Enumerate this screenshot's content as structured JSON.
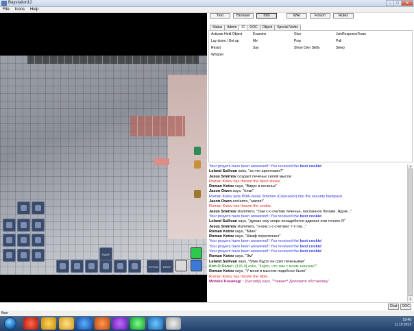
{
  "window": {
    "title": "Baystation12"
  },
  "menu": [
    "File",
    "Icons",
    "Help"
  ],
  "tabs": {
    "top": [
      {
        "label": "Text",
        "active": false
      },
      {
        "label": "Browser",
        "active": false
      },
      {
        "label": "Info",
        "active": true
      },
      {
        "label": "Wiki",
        "active": false
      },
      {
        "label": "Forum",
        "active": false
      },
      {
        "label": "Rules",
        "active": false
      }
    ],
    "stat": [
      {
        "label": "Status",
        "active": false
      },
      {
        "label": "Admin",
        "active": false
      },
      {
        "label": "IC",
        "active": true
      },
      {
        "label": "OOC",
        "active": false
      },
      {
        "label": "Object",
        "active": false
      },
      {
        "label": "Special Verbs",
        "active": false
      }
    ]
  },
  "verbs": [
    [
      "Activate Held Object",
      "Examine",
      "Give",
      "JoinResponseTeam"
    ],
    [
      "Lay down / Get up",
      "Me",
      "Pray",
      "Pull"
    ],
    [
      "Resist",
      "Say",
      "Show Own Skills",
      "Sleep"
    ],
    [
      "Whisper",
      "",
      "",
      ""
    ]
  ],
  "hud": {
    "swap_label": "SWAP",
    "throw_label": "THROW",
    "drop_label": "DROP"
  },
  "chat": [
    {
      "type": "prayer",
      "text": "Your prayers have been answered!! You received the ",
      "bold": "best cookie",
      "after": "!"
    },
    {
      "type": "say",
      "name": "Leland Sullivan",
      "text": " asks, \"за что арестован?\""
    },
    {
      "type": "say",
      "name": "Jesus Smirnov",
      "text": " создает печенье силой мысли"
    },
    {
      "type": "red",
      "text": "Roman Kotov has thrown the black shoes."
    },
    {
      "type": "say",
      "name": "Roman Kotov",
      "text": " says, \"Вирус в печенье\""
    },
    {
      "type": "say",
      "name": "Jason Owen",
      "text": " says, \"ёлки\""
    },
    {
      "type": "blue",
      "text": "Roman Kotov puts PDA-Jesus Smirnov (Counselor) into the security backpack."
    },
    {
      "type": "say",
      "name": "Jason Owen",
      "text": " exclaims, \"магия!\""
    },
    {
      "type": "red",
      "text": "Roman Kotov has thrown the cookie."
    },
    {
      "type": "say",
      "name": "Jesus Smirnov",
      "text": " stammers, \"Они с-с-считаю печенье, посланное богами, Ядом...\""
    },
    {
      "type": "prayer",
      "text": "Your prayers have been answered!! You received the ",
      "bold": "best cookie",
      "after": "!"
    },
    {
      "type": "say",
      "name": "Leland Sullivan",
      "text": " says, \"думаю ему скоро понадобится адвокат или точнее Я\""
    },
    {
      "type": "say",
      "name": "Jesus Smirnov",
      "text": " stammers, \"о-они с-с-считают т-т-так...\""
    },
    {
      "type": "say",
      "name": "Roman Kotov",
      "text": " says, \"Блин\""
    },
    {
      "type": "say",
      "name": "Roman Kotov",
      "text": " says, \"Шкаф переполнен\""
    },
    {
      "type": "prayer",
      "text": "Your prayers have been answered!! You received the ",
      "bold": "best cookie",
      "after": "!"
    },
    {
      "type": "prayer",
      "text": "Your prayers have been answered!! You received the ",
      "bold": "best cookie",
      "after": "!"
    },
    {
      "type": "prayer",
      "text": "Your prayers have been answered!! You received the ",
      "bold": "best cookie",
      "after": "!"
    },
    {
      "type": "say",
      "name": "Roman Kotov",
      "text": " says, \"Эм\""
    },
    {
      "type": "say",
      "name": "Leland Sullivan",
      "text": " says, \"блин будто он срет печеньями\""
    },
    {
      "type": "green",
      "name": "Koh O Donel",
      "mark": "↑ ",
      "text": "[145.9] asks, \"Карго, что там с моим заказом?\""
    },
    {
      "type": "say",
      "name": "Roman Kotov",
      "text": " says, \"У меня в мыслях подобное было\""
    },
    {
      "type": "red",
      "text": "Roman Kotov has thrown the bible."
    },
    {
      "type": "pink",
      "name": "Motoko Kusanagi",
      "mark": " ↑ ",
      "text": "[Security] says, \"*зевает* Доложите обстановку\""
    }
  ],
  "input": {
    "command": "",
    "chat_label": "Chat",
    "ooc_label": "OOC"
  },
  "status_text": "floor",
  "tray": {
    "time": "19:40",
    "date": "11.10.2012"
  }
}
